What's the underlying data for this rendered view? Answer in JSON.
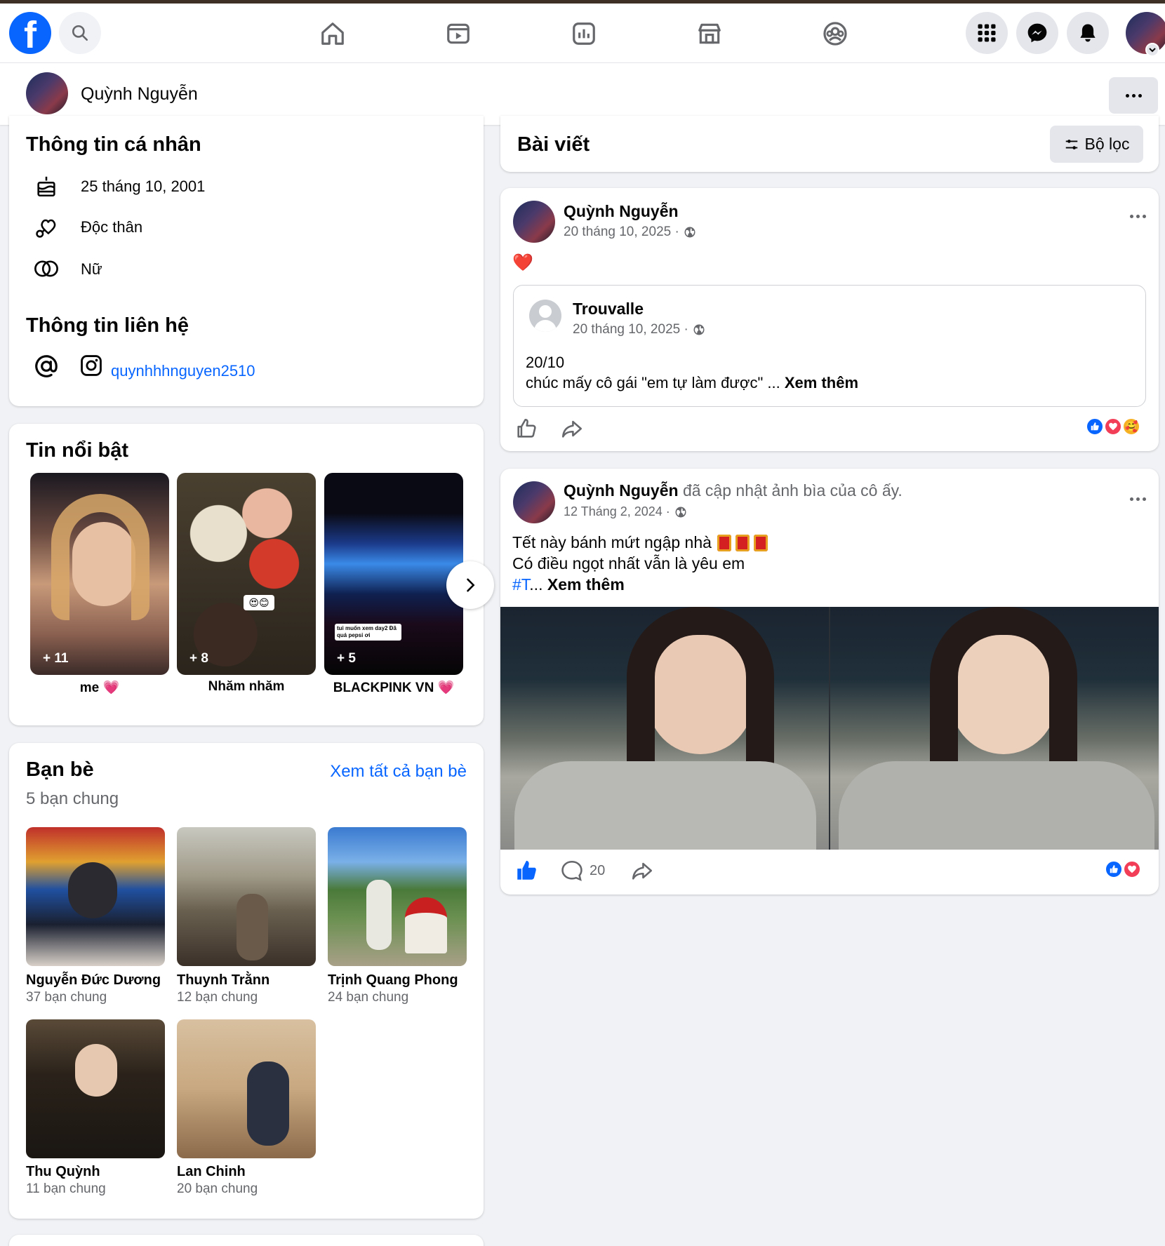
{
  "nav": {
    "logo": "f",
    "tabs": [
      "home-icon",
      "video-icon",
      "dashboard-icon",
      "marketplace-icon",
      "groups-icon"
    ],
    "right_buttons": [
      "menu-grid-icon",
      "messenger-icon",
      "bell-icon",
      "account-avatar"
    ]
  },
  "profile_bar": {
    "name": "Quỳnh Nguyễn"
  },
  "personal_info": {
    "title": "Thông tin cá nhân",
    "birthday": "25 tháng 10, 2001",
    "relationship": "Độc thân",
    "gender": "Nữ"
  },
  "contact_info": {
    "title": "Thông tin liên hệ",
    "instagram": "quynhhhnguyen2510"
  },
  "highlights": {
    "title": "Tin nổi bật",
    "items": [
      {
        "label": "me",
        "emoji": "💗",
        "count": "+ 11"
      },
      {
        "label": "Nhăm nhăm",
        "emoji": "",
        "count": "+ 8"
      },
      {
        "label": "BLACKPINK VN",
        "emoji": "💗",
        "count": "+ 5",
        "overlay": "tui muốn xem day2 Đã quá pepsi ơi"
      }
    ]
  },
  "friends": {
    "title": "Bạn bè",
    "subtitle": "5 bạn chung",
    "see_all": "Xem tất cả bạn bè",
    "items": [
      {
        "name": "Nguyễn Đức Dương",
        "mutual": "37 bạn chung"
      },
      {
        "name": "Thuynh Trằnn",
        "mutual": "12 bạn chung"
      },
      {
        "name": "Trịnh Quang Phong",
        "mutual": "24 bạn chung"
      },
      {
        "name": "Thu Quỳnh",
        "mutual": "11 bạn chung"
      },
      {
        "name": "Lan Chinh",
        "mutual": "20 bạn chung"
      }
    ]
  },
  "posts_header": {
    "title": "Bài viết",
    "filter": "Bộ lọc"
  },
  "post1": {
    "author": "Quỳnh Nguyễn",
    "date": "20 tháng 10, 2025 ·",
    "text": "❤️",
    "shared": {
      "author": "Trouvalle",
      "date": "20 tháng 10, 2025 ·",
      "line1": "20/10",
      "line2": "chúc mấy cô gái \"em tự làm được\" ...",
      "see_more": "Xem thêm"
    }
  },
  "post2": {
    "author": "Quỳnh Nguyễn",
    "action": "đã cập nhật ảnh bìa của cô ấy.",
    "date": "12 Tháng 2, 2024 ·",
    "line1": "Tết này bánh mứt ngập nhà",
    "line2": "Có điều ngọt nhất vẫn là yêu em",
    "hashtag": "#T",
    "ellipsis": "...",
    "see_more": "Xem thêm",
    "comments": "20"
  },
  "colors": {
    "brand": "#0866ff",
    "background": "#f0f2f5",
    "love": "#f33e58"
  }
}
